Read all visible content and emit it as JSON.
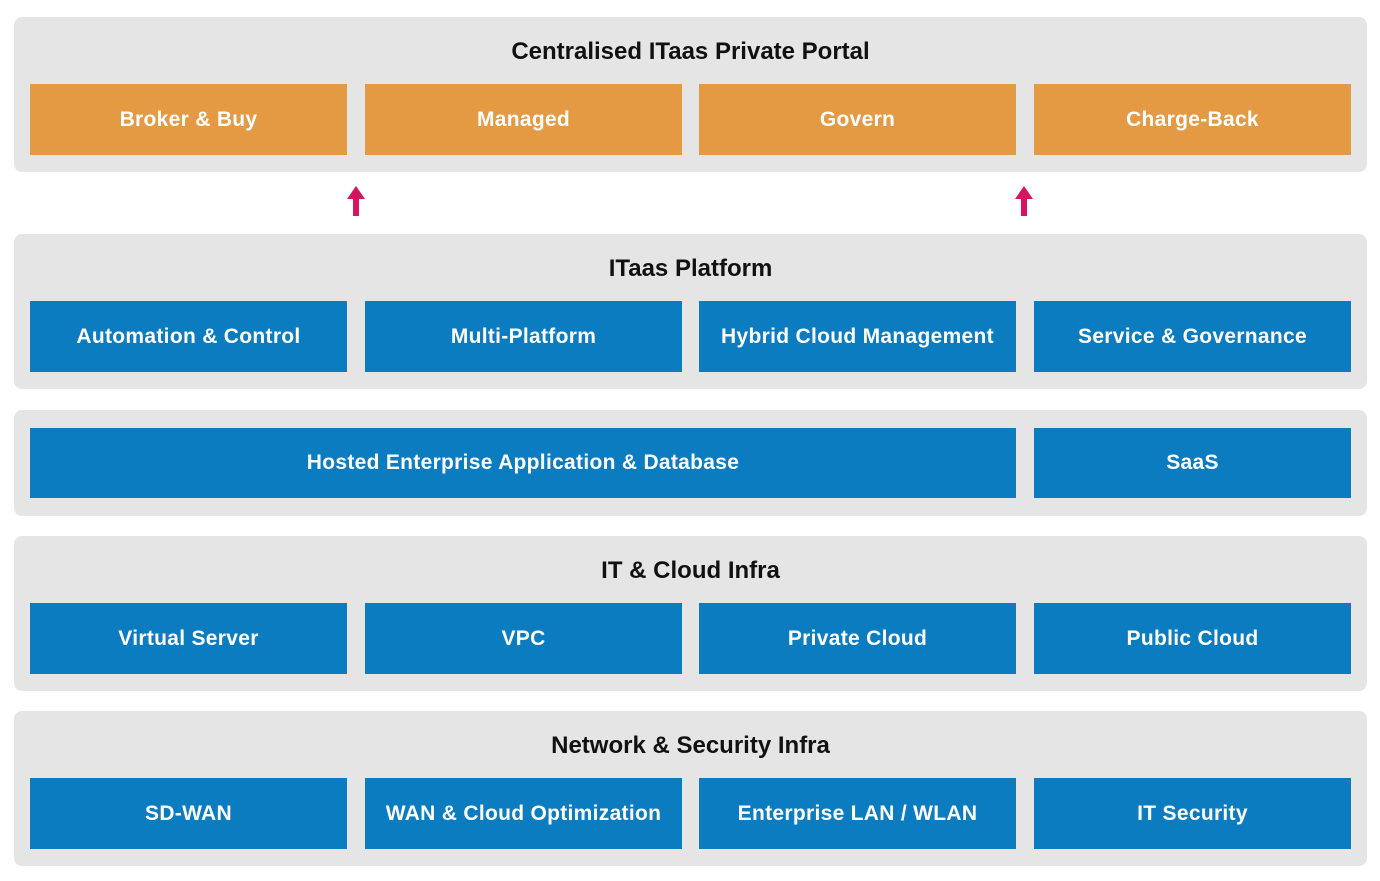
{
  "colors": {
    "panel_bg": "#e5e5e5",
    "portal_box": "#e49a43",
    "layer_box": "#0c7cc1",
    "arrow": "#d6145f"
  },
  "portal": {
    "title": "Centralised ITaas Private Portal",
    "items": [
      "Broker & Buy",
      "Managed",
      "Govern",
      "Charge-Back"
    ]
  },
  "arrows": [
    {
      "icon": "arrow-up-icon",
      "direction": "up"
    },
    {
      "icon": "arrow-up-icon",
      "direction": "up"
    }
  ],
  "platform": {
    "title": "ITaas Platform",
    "items": [
      "Automation & Control",
      "Multi-Platform",
      "Hybrid Cloud Management",
      "Service & Governance"
    ]
  },
  "applications": {
    "items": [
      "Hosted Enterprise Application & Database",
      "SaaS"
    ]
  },
  "cloud_infra": {
    "title": "IT & Cloud Infra",
    "items": [
      "Virtual Server",
      "VPC",
      "Private Cloud",
      "Public Cloud"
    ]
  },
  "network_infra": {
    "title": "Network & Security Infra",
    "items": [
      "SD-WAN",
      "WAN & Cloud Optimization",
      "Enterprise LAN / WLAN",
      "IT Security"
    ]
  }
}
